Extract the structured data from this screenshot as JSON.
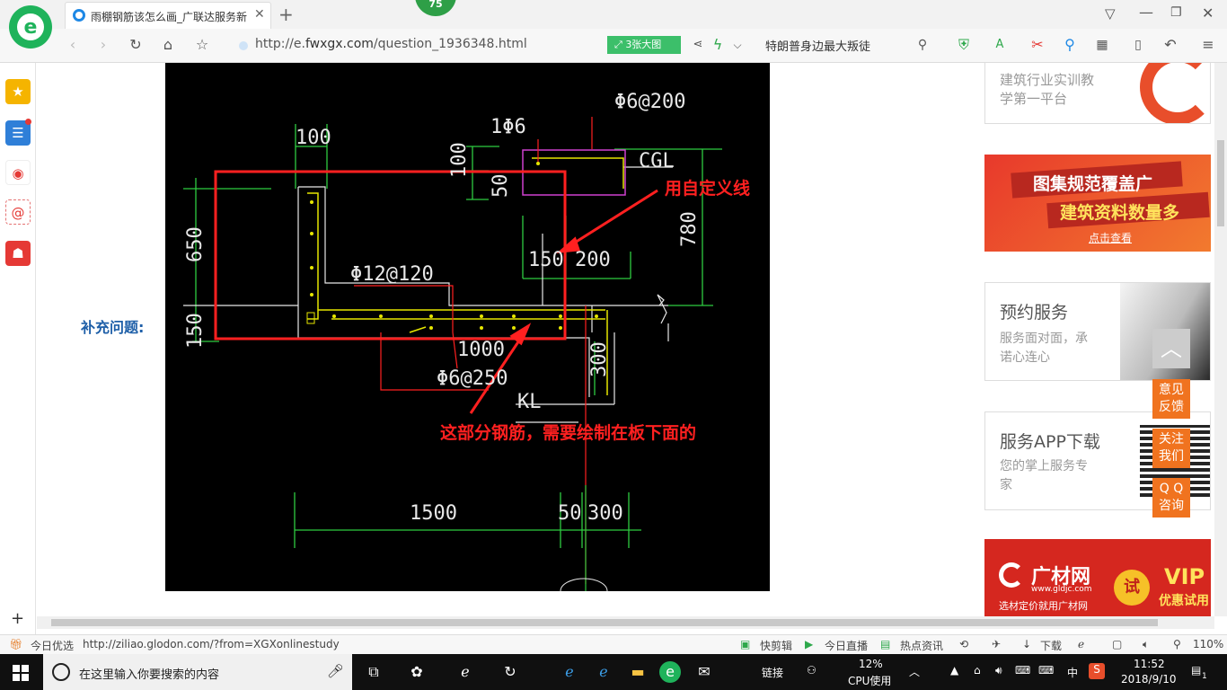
{
  "browser": {
    "tab_title": "雨棚钢筋该怎么画_广联达服务新",
    "badge_count": "75",
    "url_prefix": "http://e.",
    "url_domain": "fwxgx.com",
    "url_path": "/question_1936348.html",
    "image_badge": "3张大图",
    "search_text": "特朗普身边最大叛徒"
  },
  "page": {
    "supplement_label": "补充问题:"
  },
  "cad": {
    "dims": {
      "d100": "100",
      "d1phi6": "1Φ6",
      "d_phi6_200": "Φ6@200",
      "d_100v": "100",
      "d_50v": "50",
      "cgl": "CGL",
      "d650": "650",
      "d150a": "150",
      "d150b": "150",
      "d200": "200",
      "d780": "780",
      "phi12": "Φ12@120",
      "d1000": "1000",
      "phi6_250": "Φ6@250",
      "d300v": "300",
      "kl": "KL",
      "d1500": "1500",
      "d50": "50",
      "d300": "300"
    },
    "note_custom_line": "用自定义线",
    "note_rebar": "这部分钢筋，需要绘制在板下面的"
  },
  "sidebar_right": {
    "card1": {
      "line1": "建筑行业实训教",
      "line2": "学第一平台"
    },
    "banner1": {
      "line1": "图集规范覆盖广",
      "line2": "建筑资料数量多",
      "cta": "点击查看"
    },
    "card2": {
      "title": "预约服务",
      "line1": "服务面对面，承",
      "line2": "诺心连心"
    },
    "card3": {
      "title": "服务APP下载",
      "line1": "您的掌上服务专",
      "line2": "家"
    },
    "banner2": {
      "brand": "广材网",
      "domain": "www.gldjc.com",
      "slogan": "选材定价就用广材网",
      "trial": "试",
      "vip": "VIP",
      "vip_sub": "优惠试用"
    },
    "float": {
      "feedback1": "意见",
      "feedback2": "反馈",
      "follow1": "关注",
      "follow2": "我们",
      "qq1": "Q Q",
      "qq2": "咨询"
    }
  },
  "statusbar": {
    "today": "今日优选",
    "url": "http://ziliao.glodon.com/?from=XGXonlinestudy",
    "clip": "快剪辑",
    "live": "今日直播",
    "hot": "热点资讯",
    "download": "下载",
    "zoom": "110%"
  },
  "taskbar": {
    "search_placeholder": "在这里输入你要搜索的内容",
    "link": "链接",
    "cpu_pct": "12%",
    "cpu_label": "CPU使用",
    "lang": "中",
    "time": "11:52",
    "date": "2018/9/10",
    "notif": "1"
  },
  "colors": {
    "accent_blue": "#1e5fa8",
    "orange": "#f0731f",
    "cad_red": "#ff2020",
    "cad_green": "#2ecc40",
    "cad_yellow": "#e6e600",
    "cad_white": "#e8e8e8"
  }
}
